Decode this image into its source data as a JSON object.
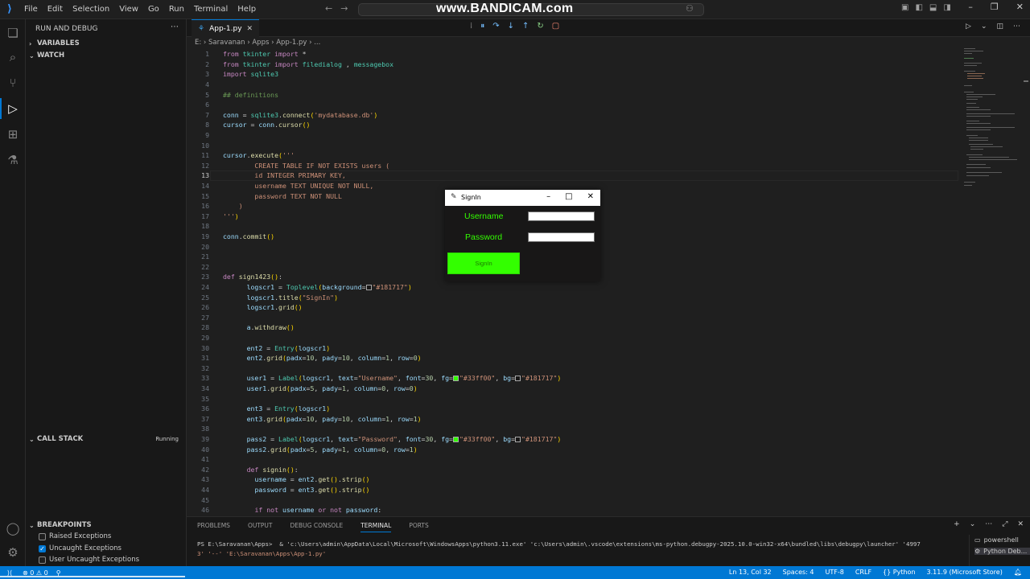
{
  "titlebar": {
    "menu": [
      "File",
      "Edit",
      "Selection",
      "View",
      "Go",
      "Run",
      "Terminal",
      "Help"
    ],
    "watermark": "www.BANDICAM.com"
  },
  "sidebar": {
    "title": "RUN AND DEBUG",
    "variables": "VARIABLES",
    "watch": "WATCH",
    "call_stack": "CALL STACK",
    "call_stack_status": "Running",
    "breakpoints": "BREAKPOINTS",
    "breakpoint_items": [
      {
        "label": "Raised Exceptions",
        "checked": false
      },
      {
        "label": "Uncaught Exceptions",
        "checked": true
      },
      {
        "label": "User Uncaught Exceptions",
        "checked": false
      }
    ]
  },
  "editor": {
    "tab_label": "App-1.py",
    "breadcrumb": "E: › Saravanan › Apps › App-1.py › ...",
    "current_line": 13
  },
  "tk_window": {
    "title": "SignIn",
    "username_label": "Username",
    "password_label": "Password",
    "button_label": "SignIn",
    "label_color": "#33ff00",
    "background": "#181717"
  },
  "panel": {
    "tabs": [
      "PROBLEMS",
      "OUTPUT",
      "DEBUG CONSOLE",
      "TERMINAL",
      "PORTS"
    ],
    "active_tab": "TERMINAL",
    "terminal_line1": "PS E:\\Saravanan\\Apps>  & 'c:\\Users\\admin\\AppData\\Local\\Microsoft\\WindowsApps\\python3.11.exe' 'c:\\Users\\admin\\.vscode\\extensions\\ms-python.debugpy-2025.10.0-win32-x64\\bundled\\libs\\debugpy\\launcher' '4997",
    "terminal_line2": "3' '--' 'E:\\Saravanan\\Apps\\App-1.py'",
    "terminals": [
      "powershell",
      "Python Deb..."
    ]
  },
  "statusbar": {
    "errors": "0",
    "warnings": "0",
    "position": "Ln 13, Col 32",
    "spaces": "Spaces: 4",
    "encoding": "UTF-8",
    "eol": "CRLF",
    "language": "Python",
    "interpreter": "3.11.9 (Microsoft Store)",
    "accent": "#0078d4"
  }
}
